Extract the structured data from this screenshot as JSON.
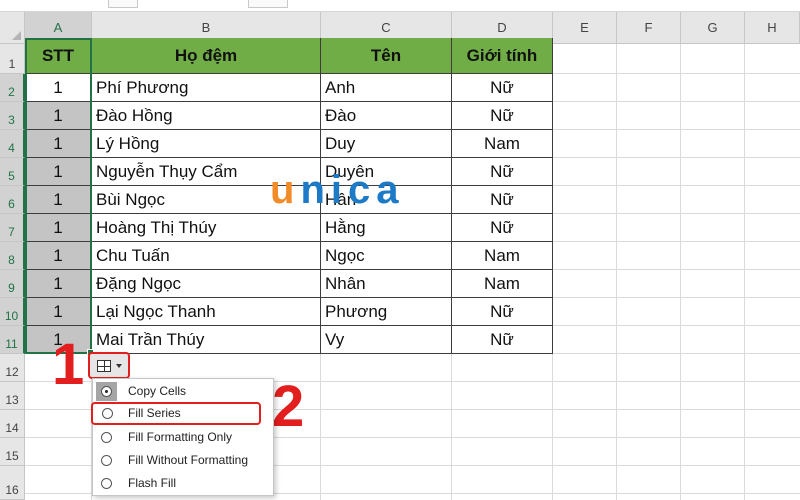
{
  "columns": [
    "A",
    "B",
    "C",
    "D",
    "E",
    "F",
    "G",
    "H"
  ],
  "rows": [
    "1",
    "2",
    "3",
    "4",
    "5",
    "6",
    "7",
    "8",
    "9",
    "10",
    "11",
    "12",
    "13",
    "14",
    "15",
    "16"
  ],
  "table": {
    "headers": [
      "STT",
      "Họ đệm",
      "Tên",
      "Giới tính"
    ],
    "rows": [
      [
        "1",
        "Phí Phương",
        "Anh",
        "Nữ"
      ],
      [
        "1",
        "Đào Hồng",
        "Đào",
        "Nữ"
      ],
      [
        "1",
        "Lý Hồng",
        "Duy",
        "Nam"
      ],
      [
        "1",
        "Nguyễn Thụy Cẩm",
        "Duyên",
        "Nữ"
      ],
      [
        "1",
        "Bùi Ngọc",
        "Hân",
        "Nữ"
      ],
      [
        "1",
        "Hoàng Thị Thúy",
        "Hằng",
        "Nữ"
      ],
      [
        "1",
        "Chu Tuấn",
        "Ngọc",
        "Nam"
      ],
      [
        "1",
        "Đặng Ngọc",
        "Nhân",
        "Nam"
      ],
      [
        "1",
        "Lại Ngọc Thanh",
        "Phương",
        "Nữ"
      ],
      [
        "1",
        "Mai Trần Thúy",
        "Vy",
        "Nữ"
      ]
    ]
  },
  "watermark": {
    "first": "u",
    "rest": "nica"
  },
  "callouts": {
    "one": "1",
    "two": "2"
  },
  "autofill_menu": {
    "button_icon": "auto-fill-options-icon",
    "items": [
      {
        "label": "Copy Cells",
        "selected": true
      },
      {
        "label": "Fill Series",
        "selected": false
      },
      {
        "label": "Fill Formatting Only",
        "selected": false
      },
      {
        "label": "Fill Without Formatting",
        "selected": false
      },
      {
        "label": "Flash Fill",
        "selected": false
      }
    ]
  },
  "colors": {
    "header_fill": "#70ad47",
    "selection_green": "#217346",
    "callout_red": "#e21e1e",
    "watermark_blue": "#1d7ac7",
    "watermark_orange": "#f28c28"
  }
}
